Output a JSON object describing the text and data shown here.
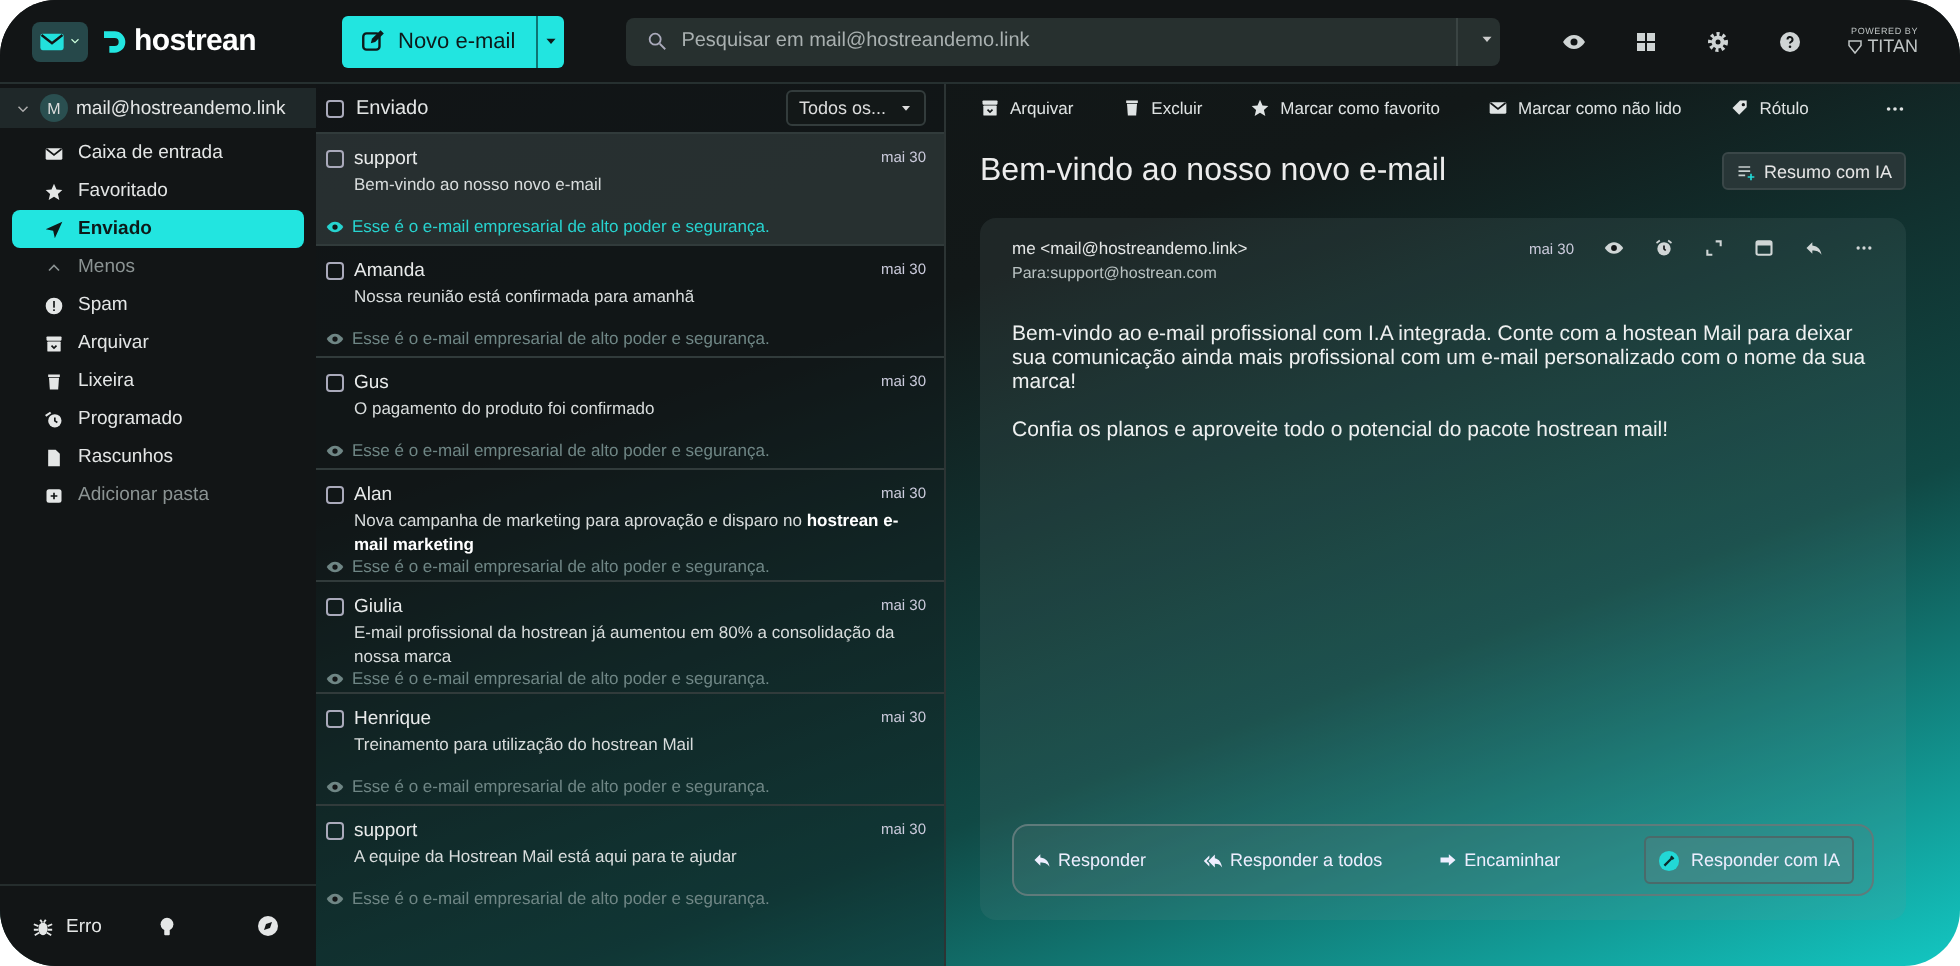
{
  "top_bar": {
    "logo": "hostrean",
    "compose_button": "Novo e-mail",
    "search": {
      "placeholder": "Pesquisar em mail@hostreandemo.link"
    },
    "powered_by": "POWERED BY",
    "brand": "TITAN"
  },
  "sidebar": {
    "account": {
      "avatar": "M",
      "email": "mail@hostreandemo.link",
      "expanded": true
    },
    "items": [
      {
        "kind": "folder",
        "label": "Caixa de entrada",
        "selected": false
      },
      {
        "kind": "folder",
        "label": "Favoritado",
        "selected": false
      },
      {
        "kind": "folder",
        "label": "Enviado",
        "selected": true
      },
      {
        "kind": "toggle",
        "label": "Menos",
        "expanded": true
      },
      {
        "kind": "folder",
        "label": "Spam",
        "selected": false
      },
      {
        "kind": "folder",
        "label": "Arquivar",
        "selected": false
      },
      {
        "kind": "folder",
        "label": "Lixeira",
        "selected": false
      },
      {
        "kind": "folder",
        "label": "Programado",
        "selected": false
      },
      {
        "kind": "folder",
        "label": "Rascunhos",
        "selected": false
      },
      {
        "kind": "add",
        "label": "Adicionar pasta"
      }
    ],
    "footer": {
      "error_label": "Erro"
    }
  },
  "message_list": {
    "title": "Enviado",
    "checked": false,
    "filter": "Todos os...",
    "messages": [
      {
        "sender": "support",
        "subject": "Bem-vindo ao nosso novo e-mail",
        "preview": "Esse é o e-mail empresarial de alto poder e segurança.",
        "date": "mai 30",
        "selected": true,
        "checked": false
      },
      {
        "sender": "Amanda",
        "subject": "Nossa reunião está confirmada para amanhã",
        "preview": "Esse é o e-mail empresarial de alto poder e segurança.",
        "date": "mai 30",
        "selected": false,
        "checked": false
      },
      {
        "sender": "Gus",
        "subject": "O pagamento do produto foi confirmado",
        "preview": "Esse é o e-mail empresarial de alto poder e segurança.",
        "date": "mai 30",
        "selected": false,
        "checked": false
      },
      {
        "sender": "Alan",
        "subject": "Nova campanha de marketing para aprovação e disparo no **hostrean e-mail marketing**",
        "preview": "Esse é o e-mail empresarial de alto poder e segurança.",
        "date": "mai 30",
        "selected": false,
        "checked": false
      },
      {
        "sender": "Giulia",
        "subject": "E-mail profissional da hostrean já aumentou em 80% a consolidação da nossa marca",
        "preview": "Esse é o e-mail empresarial de alto poder e segurança.",
        "date": "mai 30",
        "selected": false,
        "checked": false
      },
      {
        "sender": "Henrique",
        "subject": "Treinamento para utilização do hostrean Mail",
        "preview": "Esse é o e-mail empresarial de alto poder e segurança.",
        "date": "mai 30",
        "selected": false,
        "checked": false
      },
      {
        "sender": "support",
        "subject": "A equipe da Hostrean Mail está aqui para te ajudar",
        "preview": "Esse é o e-mail empresarial de alto poder e segurança.",
        "date": "mai 30",
        "selected": false,
        "checked": false
      }
    ]
  },
  "reader": {
    "toolbar": [
      "Arquivar",
      "Excluir",
      "Marcar como favorito",
      "Marcar como não lido",
      "Rótulo"
    ],
    "title": "Bem-vindo ao nosso novo e-mail",
    "summary_button": "Resumo com IA",
    "message": {
      "from": "me <mail@hostreandemo.link>",
      "to": "Para:support@hostrean.com",
      "date": "mai 30",
      "body": [
        "Bem-vindo ao e-mail profissional com I.A integrada. Conte com a hostean Mail para deixar sua comunicação ainda mais profissional com um e-mail personalizado com o nome da sua marca!",
        "Confia os planos e aproveite todo o potencial do pacote hostrean mail!"
      ]
    },
    "actions": [
      {
        "kind": "reply",
        "label": "Responder"
      },
      {
        "kind": "reply_all",
        "label": "Responder a todos"
      },
      {
        "kind": "forward",
        "label": "Encaminhar"
      },
      {
        "kind": "ai",
        "label": "Responder com IA"
      }
    ]
  }
}
